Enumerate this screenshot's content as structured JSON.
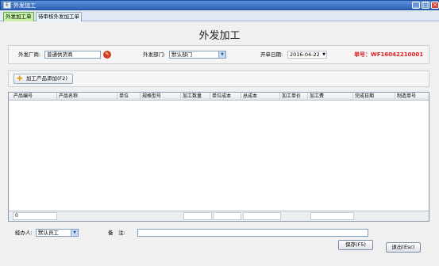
{
  "window": {
    "title": "外发加工",
    "app_icon_glyph": "E",
    "min_glyph": "_",
    "max_glyph": "□",
    "close_glyph": "×"
  },
  "tabs": [
    {
      "label": "外发加工单",
      "active": true
    },
    {
      "label": "待审核外发加工单",
      "active": false
    }
  ],
  "form_title": "外发加工",
  "header": {
    "vendor_label": "外发厂商:",
    "vendor_value": "普通供货商",
    "dept_label": "外发部门:",
    "dept_value": "默认部门",
    "date_label": "开单日期:",
    "date_value": "2016-04-22",
    "order_no_label": "单号:",
    "order_no_value": "WF16042210001",
    "order_no": "单号：WF16042210001",
    "vendor_icon": "wrench-icon"
  },
  "toolbar": {
    "add_product_label": "加工产品添加(F2)",
    "add_icon": "plus-icon"
  },
  "grid": {
    "columns": [
      "产品编号",
      "产品名称",
      "单位",
      "规格型号",
      "加工数量",
      "单位成本",
      "总成本",
      "加工单价",
      "加工费",
      "完成日期",
      "制造单号"
    ],
    "rows": [],
    "footer_count": "0"
  },
  "footer": {
    "handler_label": "经办人:",
    "handler_value": "默认员工",
    "remark_label": "备　注:",
    "remark_value": "",
    "save_label": "保存(F5)",
    "exit_label": "退出(Esc)"
  },
  "colors": {
    "accent": "#2f63b8",
    "order_no": "#e02020",
    "active_tab": "#c8f0a8"
  }
}
